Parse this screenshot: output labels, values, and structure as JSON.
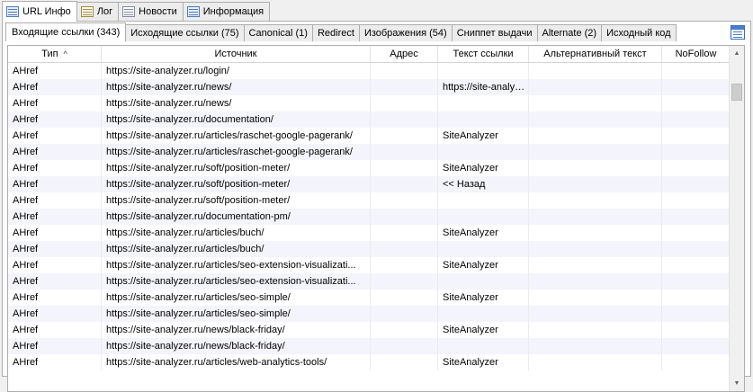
{
  "top_tabs": [
    {
      "label": "URL Инфо",
      "icon": "info-icon"
    },
    {
      "label": "Лог",
      "icon": "log-icon"
    },
    {
      "label": "Новости",
      "icon": "news-icon"
    },
    {
      "label": "Информация",
      "icon": "information-icon"
    }
  ],
  "sub_tabs": [
    "Входящие ссылки (343)",
    "Исходящие ссылки (75)",
    "Canonical (1)",
    "Redirect",
    "Изображения (54)",
    "Сниппет выдачи",
    "Alternate (2)",
    "Исходный код"
  ],
  "table": {
    "columns": [
      "Тип",
      "Источник",
      "Адрес",
      "Текст ссылки",
      "Альтернативный текст",
      "NoFollow"
    ],
    "sort_indicator": "^",
    "rows": [
      [
        "AHref",
        "https://site-analyzer.ru/login/",
        "",
        "",
        "",
        ""
      ],
      [
        "AHref",
        "https://site-analyzer.ru/news/",
        "",
        "https://site-analyzer.ru/",
        "",
        ""
      ],
      [
        "AHref",
        "https://site-analyzer.ru/news/",
        "",
        "",
        "",
        ""
      ],
      [
        "AHref",
        "https://site-analyzer.ru/documentation/",
        "",
        "",
        "",
        ""
      ],
      [
        "AHref",
        "https://site-analyzer.ru/articles/raschet-google-pagerank/",
        "",
        "SiteAnalyzer",
        "",
        ""
      ],
      [
        "AHref",
        "https://site-analyzer.ru/articles/raschet-google-pagerank/",
        "",
        "",
        "",
        ""
      ],
      [
        "AHref",
        "https://site-analyzer.ru/soft/position-meter/",
        "",
        "SiteAnalyzer",
        "",
        ""
      ],
      [
        "AHref",
        "https://site-analyzer.ru/soft/position-meter/",
        "",
        "<< Назад",
        "",
        ""
      ],
      [
        "AHref",
        "https://site-analyzer.ru/soft/position-meter/",
        "",
        "",
        "",
        ""
      ],
      [
        "AHref",
        "https://site-analyzer.ru/documentation-pm/",
        "",
        "",
        "",
        ""
      ],
      [
        "AHref",
        "https://site-analyzer.ru/articles/buch/",
        "",
        "SiteAnalyzer",
        "",
        ""
      ],
      [
        "AHref",
        "https://site-analyzer.ru/articles/buch/",
        "",
        "",
        "",
        ""
      ],
      [
        "AHref",
        "https://site-analyzer.ru/articles/seo-extension-visualizati...",
        "",
        "SiteAnalyzer",
        "",
        ""
      ],
      [
        "AHref",
        "https://site-analyzer.ru/articles/seo-extension-visualizati...",
        "",
        "",
        "",
        ""
      ],
      [
        "AHref",
        "https://site-analyzer.ru/articles/seo-simple/",
        "",
        "SiteAnalyzer",
        "",
        ""
      ],
      [
        "AHref",
        "https://site-analyzer.ru/articles/seo-simple/",
        "",
        "",
        "",
        ""
      ],
      [
        "AHref",
        "https://site-analyzer.ru/news/black-friday/",
        "",
        "SiteAnalyzer",
        "",
        ""
      ],
      [
        "AHref",
        "https://site-analyzer.ru/news/black-friday/",
        "",
        "",
        "",
        ""
      ],
      [
        "AHref",
        "https://site-analyzer.ru/articles/web-analytics-tools/",
        "",
        "SiteAnalyzer",
        "",
        ""
      ]
    ]
  },
  "scrollbar": {
    "up_icon": "▲",
    "down_icon": "▼"
  }
}
